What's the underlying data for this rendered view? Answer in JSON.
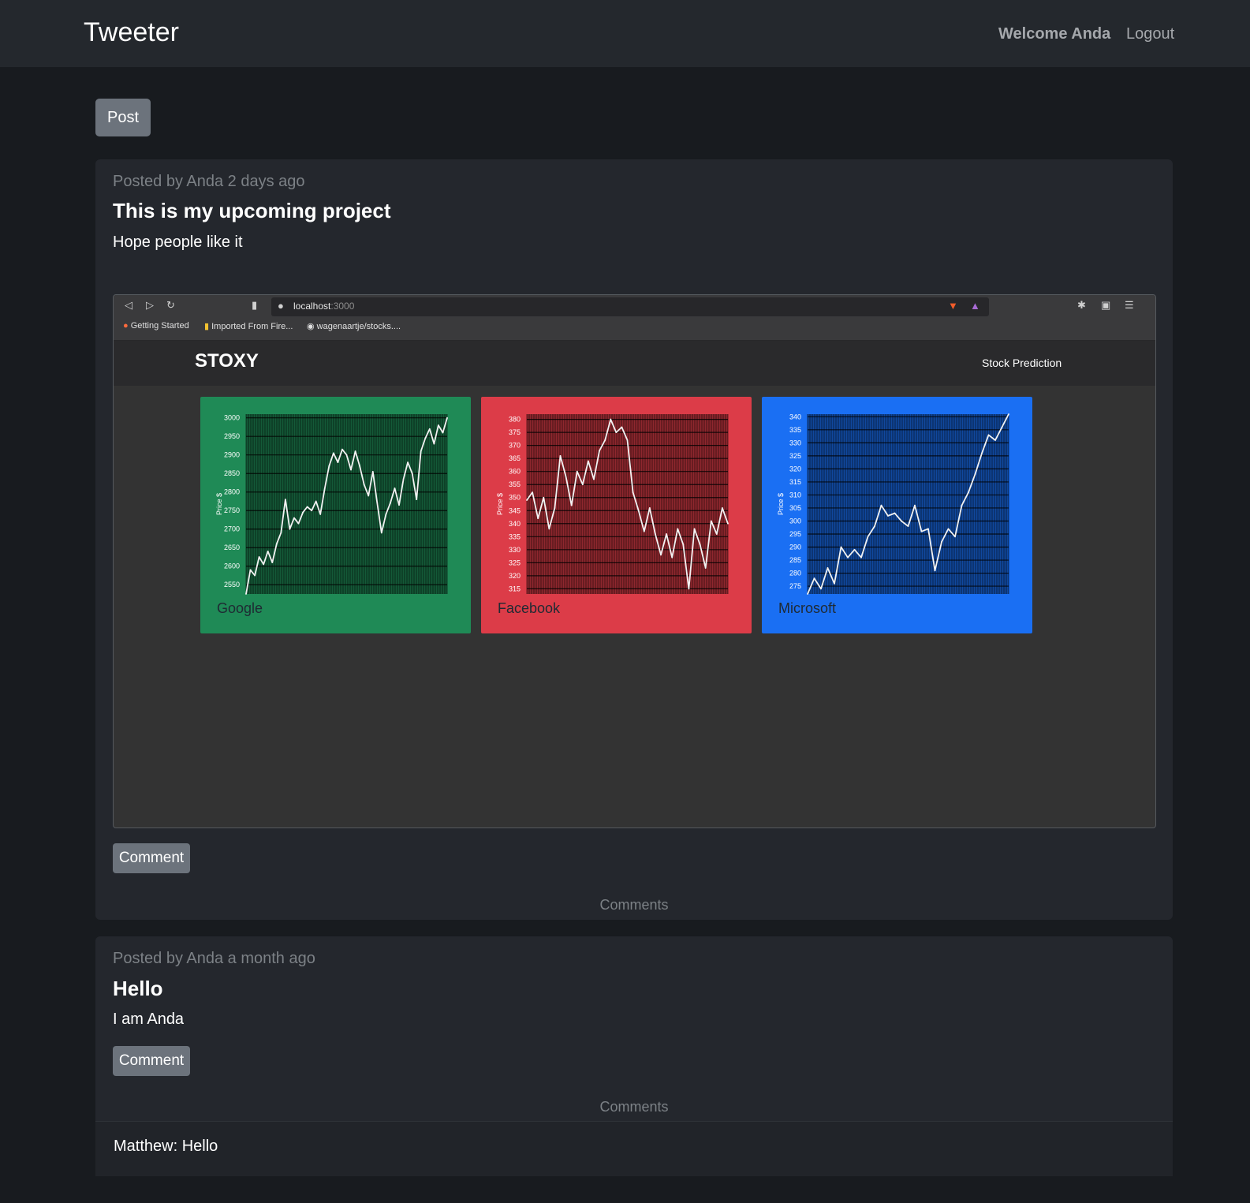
{
  "nav": {
    "brand": "Tweeter",
    "welcome": "Welcome Anda",
    "logout": "Logout"
  },
  "post_button": "Post",
  "posts": [
    {
      "meta": "Posted by Anda 2 days ago",
      "title": "This is my upcoming project",
      "body": "Hope people like it",
      "comment_button": "Comment",
      "comments_label": "Comments",
      "image": {
        "browser": {
          "url_host": "localhost",
          "url_port": ":3000",
          "bookmarks": [
            "Getting Started",
            "Imported From Fire...",
            "wagenaartje/stocks...."
          ]
        },
        "app": {
          "brand": "STOXY",
          "nav_link": "Stock Prediction"
        },
        "chart_data": [
          {
            "type": "line",
            "name": "Google",
            "ylabel": "Price $",
            "color": "#1f8a56",
            "ylim": [
              2525,
              3010
            ],
            "yticks": [
              3000,
              2950,
              2900,
              2850,
              2800,
              2750,
              2700,
              2650,
              2600,
              2550
            ],
            "values": [
              2525,
              2590,
              2575,
              2625,
              2605,
              2640,
              2610,
              2660,
              2690,
              2780,
              2700,
              2730,
              2715,
              2745,
              2760,
              2750,
              2775,
              2740,
              2810,
              2870,
              2905,
              2880,
              2915,
              2900,
              2860,
              2910,
              2870,
              2820,
              2790,
              2855,
              2770,
              2690,
              2740,
              2770,
              2810,
              2765,
              2835,
              2880,
              2850,
              2780,
              2910,
              2945,
              2970,
              2930,
              2980,
              2960,
              3000
            ]
          },
          {
            "type": "line",
            "name": "Facebook",
            "ylabel": "Price $",
            "color": "#dc3c48",
            "ylim": [
              313,
              382
            ],
            "yticks": [
              380,
              375,
              370,
              365,
              360,
              355,
              350,
              345,
              340,
              335,
              330,
              325,
              320,
              315
            ],
            "values": [
              349,
              352,
              342,
              350,
              338,
              346,
              366,
              358,
              347,
              360,
              355,
              364,
              357,
              368,
              372,
              380,
              375,
              377,
              372,
              352,
              345,
              337,
              346,
              336,
              328,
              336,
              327,
              338,
              332,
              315,
              338,
              332,
              323,
              341,
              336,
              346,
              340
            ]
          },
          {
            "type": "line",
            "name": "Microsoft",
            "ylabel": "Price $",
            "color": "#1a6ff3",
            "ylim": [
              272,
              341
            ],
            "yticks": [
              340,
              335,
              330,
              325,
              320,
              315,
              310,
              305,
              300,
              295,
              290,
              285,
              280,
              275
            ],
            "values": [
              272,
              278,
              274,
              282,
              276,
              290,
              286,
              289,
              286,
              294,
              298,
              306,
              302,
              303,
              300,
              298,
              306,
              296,
              297,
              281,
              292,
              297,
              294,
              306,
              311,
              318,
              326,
              333,
              331,
              336,
              341
            ]
          }
        ]
      }
    },
    {
      "meta": "Posted by Anda a month ago",
      "title": "Hello",
      "body": "I am Anda",
      "comment_button": "Comment",
      "comments_label": "Comments",
      "comments": [
        {
          "text": "Matthew: Hello"
        }
      ]
    }
  ]
}
